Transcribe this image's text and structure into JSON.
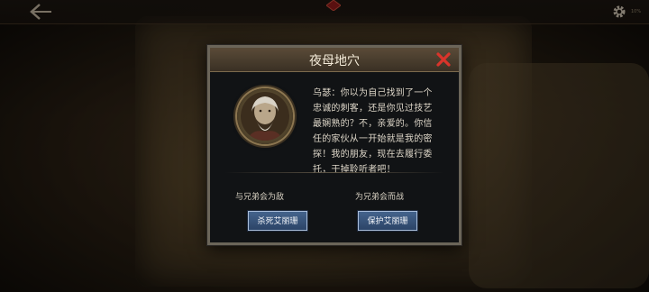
{
  "topbar": {
    "back_icon": "back-arrow-icon",
    "settings_icon": "gear-icon",
    "zoom_text": "10%"
  },
  "dialog": {
    "title": "夜母地穴",
    "close_icon": "close-x-icon",
    "portrait": "old-man-portrait",
    "story_lines": [
      "乌瑟：你以为自己找到了一个",
      "忠诚的刺客，还是你见过技艺",
      "最娴熟的？不，亲爱的。你信",
      "任的家伙从一开始就是我的密",
      "探！我的朋友，现在去履行委",
      "托，干掉聆听者吧！"
    ],
    "choices": [
      {
        "caption": "与兄弟会为敌",
        "button_label": "杀死艾丽珊"
      },
      {
        "caption": "为兄弟会而战",
        "button_label": "保护艾丽珊"
      }
    ]
  },
  "colors": {
    "header": "#4a3d2e",
    "close": "#d9342b",
    "button": "#36557d",
    "frame": "#6b6559"
  }
}
